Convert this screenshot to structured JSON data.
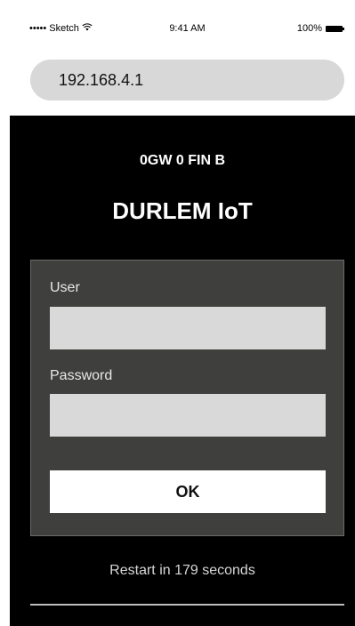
{
  "status_bar": {
    "signal": "•••••",
    "carrier": "Sketch",
    "wifi_icon": "wifi-icon",
    "time": "9:41 AM",
    "battery_percent": "100%",
    "battery_icon": "battery-icon"
  },
  "browser": {
    "address": "192.168.4.1"
  },
  "page": {
    "device_id": "0GW 0 FIN B",
    "title": "DURLEM IoT",
    "form": {
      "user_label": "User",
      "user_value": "",
      "password_label": "Password",
      "password_value": "",
      "ok_label": "OK"
    },
    "restart_text": "Restart in 179 seconds"
  },
  "colors": {
    "background": "#000000",
    "panel": "#3f3f3d",
    "input": "#d9d9d9",
    "button": "#ffffff",
    "address_bar": "#d8d8d8"
  }
}
